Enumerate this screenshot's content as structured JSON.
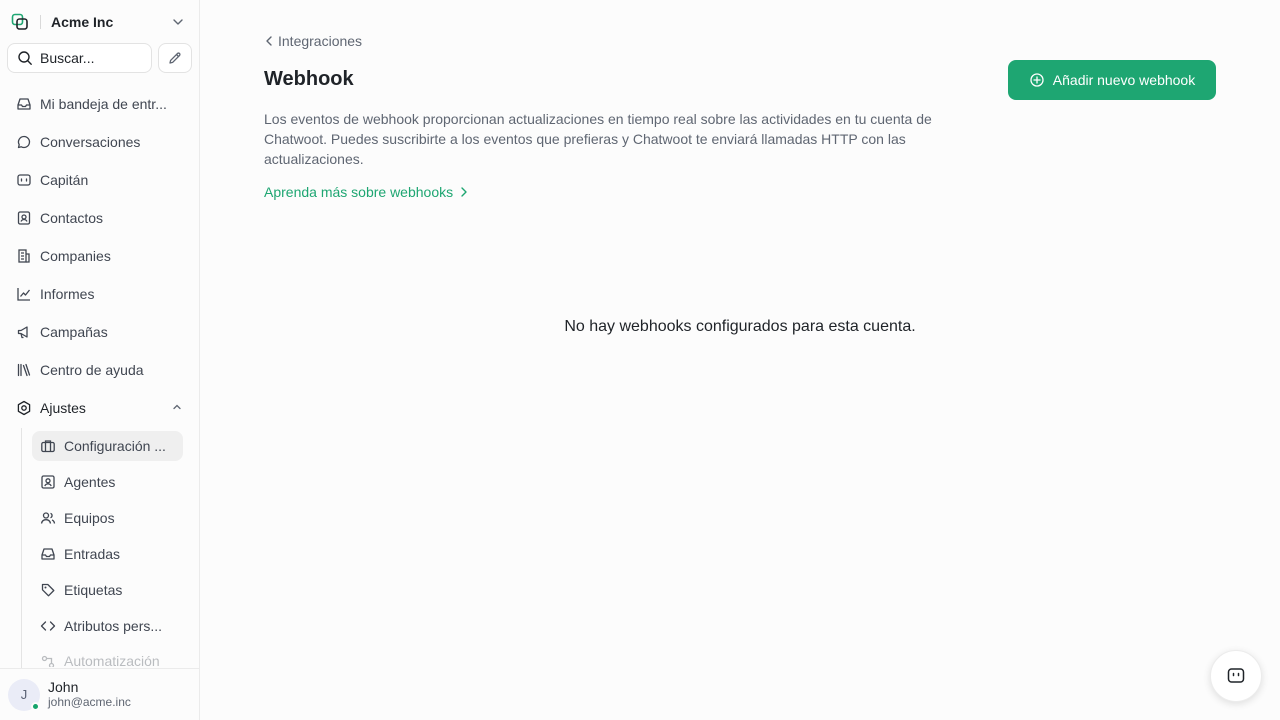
{
  "account": {
    "name": "Acme Inc"
  },
  "search": {
    "placeholder": "Buscar..."
  },
  "nav": {
    "items": [
      {
        "label": "Mi bandeja de entr...",
        "icon": "inbox-icon"
      },
      {
        "label": "Conversaciones",
        "icon": "chat-bubble-icon"
      },
      {
        "label": "Capitán",
        "icon": "captain-icon"
      },
      {
        "label": "Contactos",
        "icon": "contact-card-icon"
      },
      {
        "label": "Companies",
        "icon": "building-icon"
      },
      {
        "label": "Informes",
        "icon": "chart-line-icon"
      },
      {
        "label": "Campañas",
        "icon": "megaphone-icon"
      },
      {
        "label": "Centro de ayuda",
        "icon": "library-icon"
      }
    ],
    "settings": {
      "label": "Ajustes",
      "icon": "settings-hex-icon"
    },
    "settings_items": [
      {
        "label": "Configuración ...",
        "icon": "briefcase-icon"
      },
      {
        "label": "Agentes",
        "icon": "contact-square-icon"
      },
      {
        "label": "Equipos",
        "icon": "users-icon"
      },
      {
        "label": "Entradas",
        "icon": "inbox-icon"
      },
      {
        "label": "Etiquetas",
        "icon": "tag-icon"
      },
      {
        "label": "Atributos pers...",
        "icon": "code-icon"
      },
      {
        "label": "Automatización",
        "icon": "automation-icon"
      }
    ]
  },
  "user": {
    "initial": "J",
    "name": "John",
    "email": "john@acme.inc"
  },
  "main": {
    "back_label": "Integraciones",
    "title": "Webhook",
    "add_button": "Añadir nuevo webhook",
    "description": "Los eventos de webhook proporcionan actualizaciones en tiempo real sobre las actividades en tu cuenta de Chatwoot. Puedes suscribirte a los eventos que prefieras y Chatwoot te enviará llamadas HTTP con las actualizaciones.",
    "learn_more": "Aprenda más sobre webhooks",
    "empty_message": "No hay webhooks configurados para esta cuenta."
  },
  "colors": {
    "accent": "#1ea672",
    "online": "#15a46b"
  }
}
